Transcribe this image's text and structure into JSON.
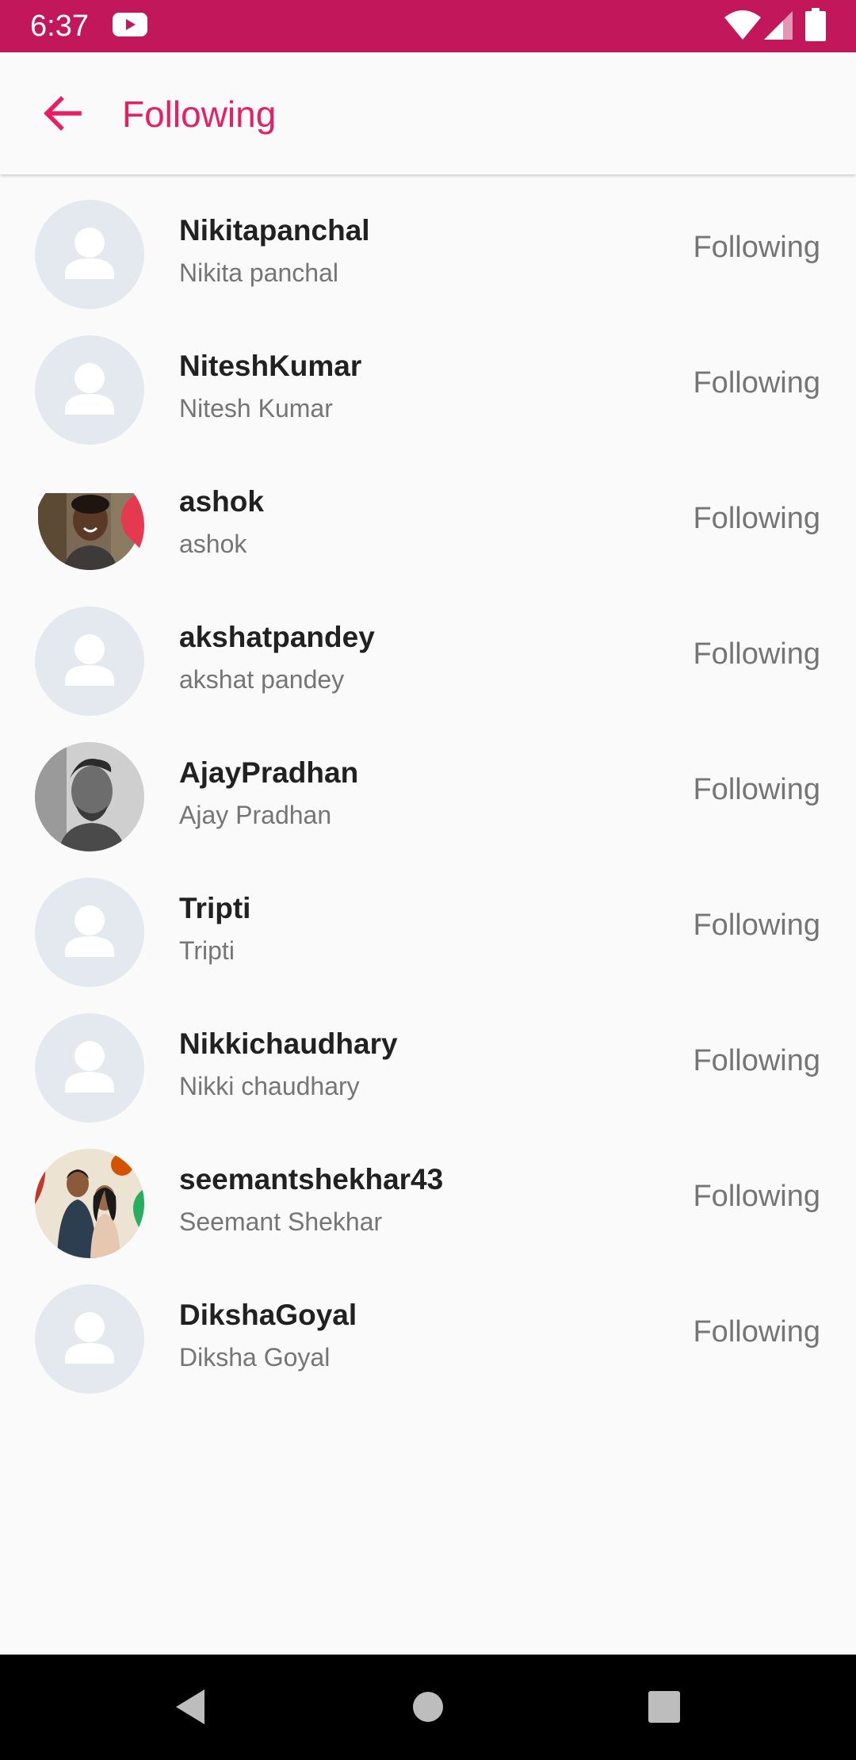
{
  "status_bar": {
    "time": "6:37",
    "icons": [
      "youtube-icon",
      "wifi-icon",
      "cellular-icon",
      "battery-icon"
    ],
    "background": "#c2185b"
  },
  "app_bar": {
    "title": "Following",
    "back_icon": "arrow-back-icon",
    "accent_color": "#e91e63"
  },
  "users": [
    {
      "username": "Nikitapanchal",
      "name": "Nikita panchal",
      "status": "Following",
      "avatar": "placeholder"
    },
    {
      "username": "NiteshKumar",
      "name": "Nitesh Kumar",
      "status": "Following",
      "avatar": "placeholder"
    },
    {
      "username": "ashok",
      "name": "ashok",
      "status": "Following",
      "avatar": "photo"
    },
    {
      "username": "akshatpandey",
      "name": "akshat pandey",
      "status": "Following",
      "avatar": "placeholder"
    },
    {
      "username": "AjayPradhan",
      "name": "Ajay Pradhan",
      "status": "Following",
      "avatar": "photo"
    },
    {
      "username": "Tripti",
      "name": "Tripti",
      "status": "Following",
      "avatar": "placeholder"
    },
    {
      "username": "Nikkichaudhary",
      "name": "Nikki chaudhary",
      "status": "Following",
      "avatar": "placeholder"
    },
    {
      "username": "seemantshekhar43",
      "name": "Seemant Shekhar",
      "status": "Following",
      "avatar": "photo"
    },
    {
      "username": "DikshaGoyal",
      "name": "Diksha Goyal",
      "status": "Following",
      "avatar": "placeholder"
    }
  ],
  "nav_bar": {
    "icons": [
      "nav-back-icon",
      "nav-home-icon",
      "nav-recents-icon"
    ]
  }
}
